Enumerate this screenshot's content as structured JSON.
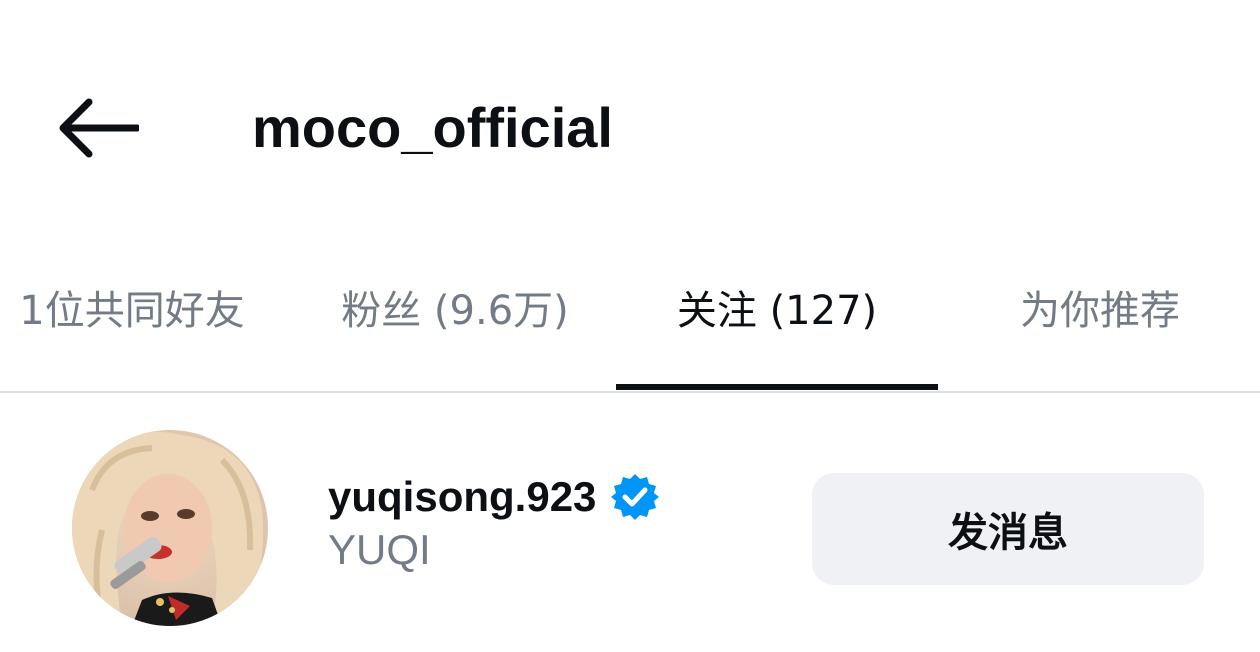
{
  "header": {
    "back_icon": "arrow-left-icon",
    "title": "moco_official"
  },
  "tabs": [
    {
      "label": "1位共同好友",
      "active": false
    },
    {
      "label": "粉丝 (9.6万)",
      "active": false
    },
    {
      "label": "关注 (127)",
      "active": true
    },
    {
      "label": "为你推荐",
      "active": false
    }
  ],
  "following": [
    {
      "username": "yuqisong.923",
      "full_name": "YUQI",
      "verified": true,
      "verified_icon": "verified-badge-icon",
      "button_label": "发消息"
    }
  ],
  "colors": {
    "text_primary": "#0c1014",
    "text_secondary": "#737b86",
    "verified_blue": "#0095f6",
    "button_bg": "#eff1f5",
    "divider": "#dbdfe4"
  }
}
